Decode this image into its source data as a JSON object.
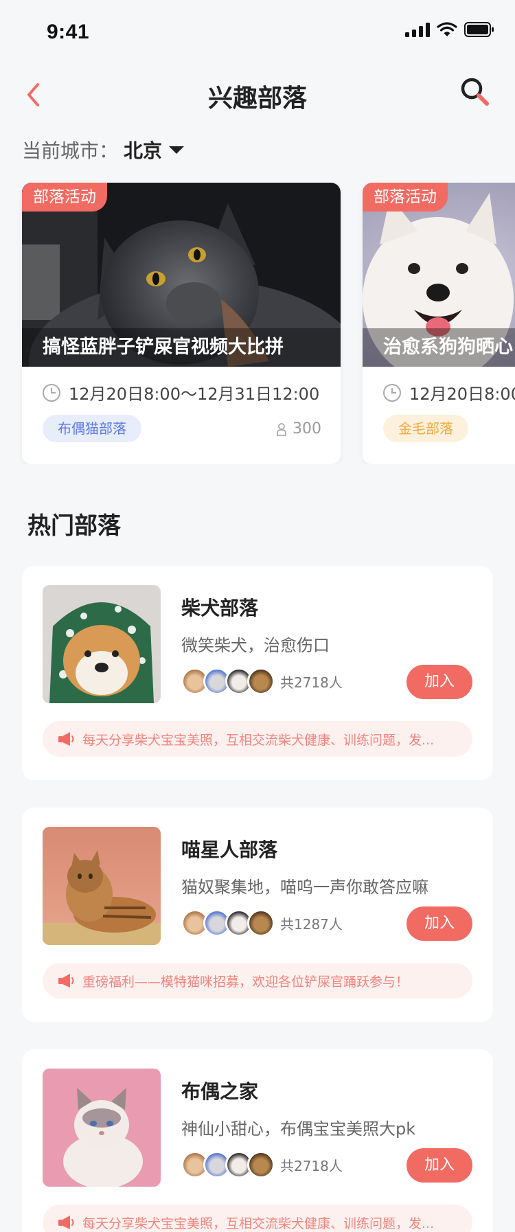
{
  "status": {
    "time": "9:41"
  },
  "nav": {
    "title": "兴趣部落"
  },
  "city": {
    "label": "当前城市：",
    "value": "北京"
  },
  "activities": [
    {
      "badge": "部落活动",
      "title": "搞怪蓝胖子铲屎官视频大比拼",
      "time": "12月20日8:00～12月31日12:00",
      "tag": "布偶猫部落",
      "count": "300",
      "tag_color": "#5b78e6",
      "tag_bg": "#e8edfc"
    },
    {
      "badge": "部落活动",
      "title": "治愈系狗狗晒心",
      "time": "12月20日8:00",
      "tag": "金毛部落",
      "tag_color": "#f2a93b",
      "tag_bg": "#fdf1de"
    }
  ],
  "section": {
    "hot_title": "热门部落"
  },
  "tribes": [
    {
      "name": "柴犬部落",
      "desc": "微笑柴犬，治愈伤口",
      "members": "共2718人",
      "join": "加入",
      "notice": "每天分享柴犬宝宝美照，互相交流柴犬健康、训练问题，发..."
    },
    {
      "name": "喵星人部落",
      "desc": "猫奴聚集地，喵呜一声你敢答应嘛",
      "members": "共1287人",
      "join": "加入",
      "notice": "重磅福利——模特猫咪招募，欢迎各位铲屎官踊跃参与！"
    },
    {
      "name": "布偶之家",
      "desc": "神仙小甜心，布偶宝宝美照大pk",
      "members": "共2718人",
      "join": "加入",
      "notice": "每天分享柴犬宝宝美照，互相交流柴犬健康、训练问题，发..."
    }
  ],
  "icons": [
    "back-arrow-icon",
    "search-icon",
    "dropdown-caret-icon",
    "clock-icon",
    "person-icon",
    "megaphone-icon"
  ],
  "colors": {
    "accent": "#f26b62",
    "notice_bg": "#fdf1f0",
    "notice_text": "#f0847c"
  }
}
